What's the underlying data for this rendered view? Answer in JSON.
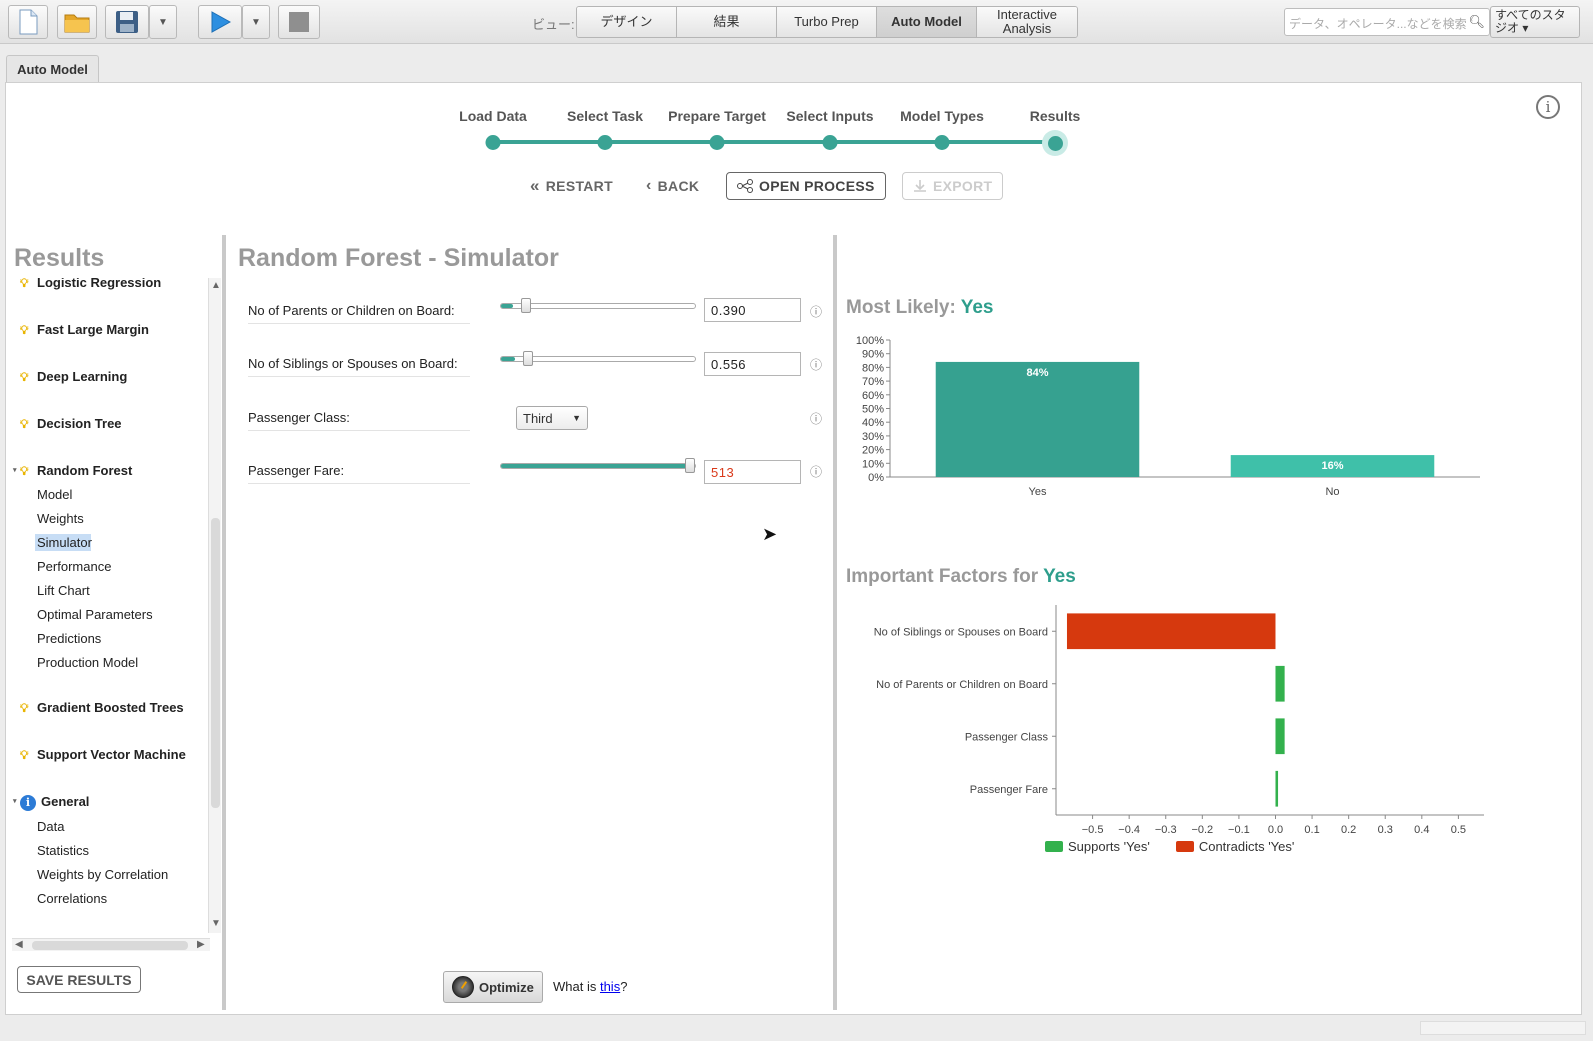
{
  "toolbar": {
    "view_label": "ビュー:",
    "view_tabs": [
      "デザイン",
      "結果",
      "Turbo Prep",
      "Auto Model",
      "Interactive Analysis"
    ],
    "active_view": "Auto Model",
    "search_placeholder": "データ、オペレータ...などを検索",
    "studio_label": "すべてのスタジオ ▾"
  },
  "doc_tab": "Auto Model",
  "stepper": {
    "steps": [
      "Load Data",
      "Select Task",
      "Prepare Target",
      "Select Inputs",
      "Model Types",
      "Results"
    ],
    "current_step": "Results"
  },
  "actions": {
    "restart": "RESTART",
    "back": "BACK",
    "open_process": "OPEN PROCESS",
    "export": "EXPORT"
  },
  "results": {
    "title": "Results",
    "items": [
      {
        "label": "Logistic Regression",
        "type": "model"
      },
      {
        "label": "Fast Large Margin",
        "type": "model"
      },
      {
        "label": "Deep Learning",
        "type": "model"
      },
      {
        "label": "Decision Tree",
        "type": "model"
      },
      {
        "label": "Random Forest",
        "type": "model",
        "expanded": true
      },
      {
        "label": "Model",
        "type": "sub"
      },
      {
        "label": "Weights",
        "type": "sub"
      },
      {
        "label": "Simulator",
        "type": "sub",
        "selected": true
      },
      {
        "label": "Performance",
        "type": "sub"
      },
      {
        "label": "Lift Chart",
        "type": "sub"
      },
      {
        "label": "Optimal Parameters",
        "type": "sub"
      },
      {
        "label": "Predictions",
        "type": "sub"
      },
      {
        "label": "Production Model",
        "type": "sub"
      },
      {
        "label": "Gradient Boosted Trees",
        "type": "model"
      },
      {
        "label": "Support Vector Machine",
        "type": "model"
      },
      {
        "label": "General",
        "type": "info",
        "expanded": true
      },
      {
        "label": "Data",
        "type": "sub"
      },
      {
        "label": "Statistics",
        "type": "sub"
      },
      {
        "label": "Weights by Correlation",
        "type": "sub"
      },
      {
        "label": "Correlations",
        "type": "sub"
      }
    ],
    "save_label": "SAVE RESULTS"
  },
  "simulator": {
    "title": "Random Forest - Simulator",
    "inputs": [
      {
        "label": "No of Parents or Children on Board:",
        "value": "0.390",
        "slider_fraction": 0.06
      },
      {
        "label": "No of Siblings or Spouses on Board:",
        "value": "0.556",
        "slider_fraction": 0.07
      },
      {
        "label": "Passenger Class:",
        "value": "Third"
      },
      {
        "label": "Passenger Fare:",
        "value": "513",
        "slider_fraction": 1.0
      }
    ],
    "info_glyph": "ⓘ",
    "optimize_label": "Optimize",
    "what_is_prefix": "What is ",
    "what_is_link": "this",
    "what_is_suffix": "?"
  },
  "most_likely": {
    "prefix": "Most Likely: ",
    "value": "Yes"
  },
  "important_factors": {
    "prefix": "Important Factors for ",
    "value": "Yes"
  },
  "colors": {
    "accent": "#3aa394",
    "bar_yes": "#36a190",
    "bar_no": "#3fc0a9",
    "supports": "#33b14d",
    "contradicts": "#d6390e"
  },
  "chart_data": [
    {
      "type": "bar",
      "categories": [
        "Yes",
        "No"
      ],
      "values": [
        84,
        16
      ],
      "data_labels": [
        "84%",
        "16%"
      ],
      "ylim": [
        0,
        100
      ],
      "yticks": [
        "0%",
        "10%",
        "20%",
        "30%",
        "40%",
        "50%",
        "60%",
        "70%",
        "80%",
        "90%",
        "100%"
      ],
      "grid": false
    },
    {
      "type": "bar",
      "orientation": "horizontal",
      "categories": [
        "No of Siblings or Spouses on Board",
        "No of Parents or Children on Board",
        "Passenger Class",
        "Passenger Fare"
      ],
      "values": [
        -0.57,
        0.025,
        0.025,
        0.007
      ],
      "xlim": [
        -0.6,
        0.57
      ],
      "xticks": [
        "−0.5",
        "−0.4",
        "−0.3",
        "−0.2",
        "−0.1",
        "0.0",
        "0.1",
        "0.2",
        "0.3",
        "0.4",
        "0.5"
      ],
      "legend": [
        "Supports 'Yes'",
        "Contradicts 'Yes'"
      ],
      "legend_position": "bottom",
      "grid": false
    }
  ]
}
